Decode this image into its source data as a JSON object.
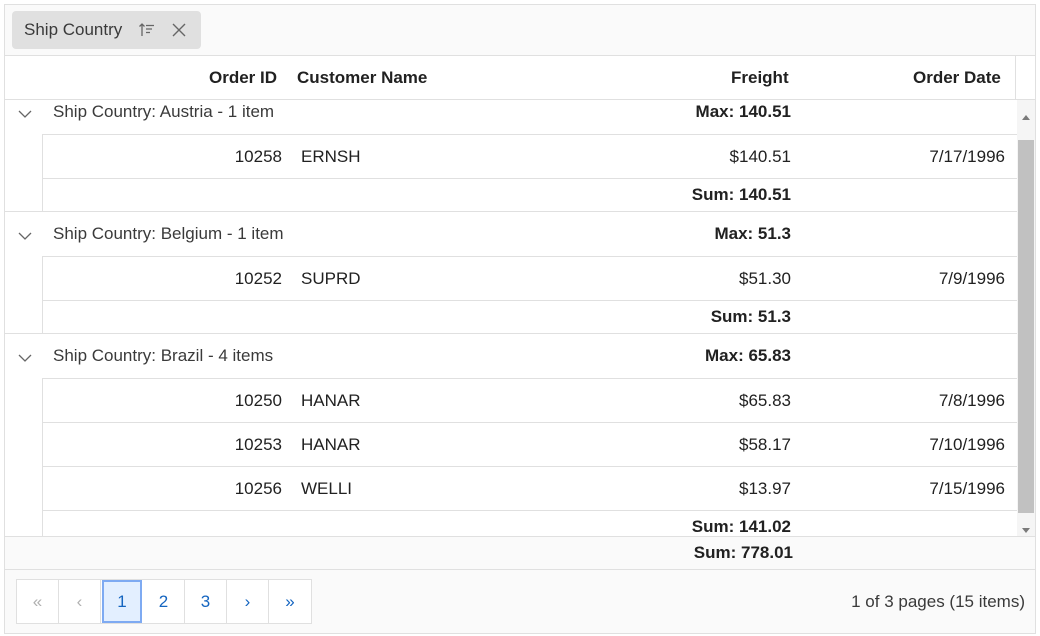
{
  "group_bar": {
    "chip_label": "Ship Country",
    "sort_icon": "sort-ascending-icon",
    "close_icon": "close-icon"
  },
  "columns": {
    "order_id": "Order ID",
    "customer_name": "Customer Name",
    "freight": "Freight",
    "order_date": "Order Date"
  },
  "groups": [
    {
      "caption": "Ship Country: Austria - 1 item",
      "max": "Max: 140.51",
      "rows": [
        {
          "order_id": "10258",
          "customer": "ERNSH",
          "freight": "$140.51",
          "date": "7/17/1996"
        }
      ],
      "sum": "Sum: 140.51"
    },
    {
      "caption": "Ship Country: Belgium - 1 item",
      "max": "Max: 51.3",
      "rows": [
        {
          "order_id": "10252",
          "customer": "SUPRD",
          "freight": "$51.30",
          "date": "7/9/1996"
        }
      ],
      "sum": "Sum: 51.3"
    },
    {
      "caption": "Ship Country: Brazil - 4 items",
      "max": "Max: 65.83",
      "rows": [
        {
          "order_id": "10250",
          "customer": "HANAR",
          "freight": "$65.83",
          "date": "7/8/1996"
        },
        {
          "order_id": "10253",
          "customer": "HANAR",
          "freight": "$58.17",
          "date": "7/10/1996"
        },
        {
          "order_id": "10256",
          "customer": "WELLI",
          "freight": "$13.97",
          "date": "7/15/1996"
        }
      ],
      "sum": "Sum: 141.02"
    }
  ],
  "footer": {
    "total_sum": "Sum: 778.01"
  },
  "pager": {
    "first": "«",
    "prev": "‹",
    "pages": [
      "1",
      "2",
      "3"
    ],
    "current_page": "1",
    "next": "›",
    "last": "»",
    "info": "1 of 3 pages (15 items)"
  },
  "colors": {
    "accent": "#1565c0",
    "active_border": "#7eaaf2",
    "border": "#e0e0e0",
    "scroll_thumb": "#c1c1c1"
  }
}
